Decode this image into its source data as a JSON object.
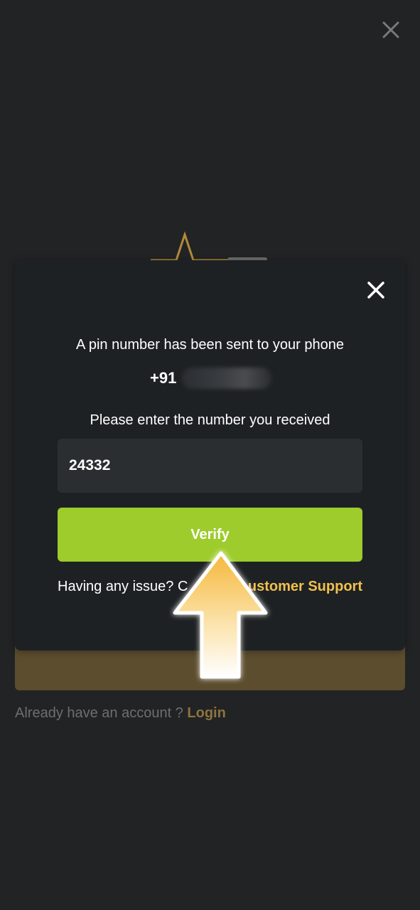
{
  "icons": {
    "top_close": "close-icon",
    "modal_close": "close-icon",
    "logo": "star-logo-icon",
    "arrow": "arrow-up-icon"
  },
  "colors": {
    "background": "#222324",
    "modal": "#1e2124",
    "verify_button": "#9dcc2c",
    "link_gold": "#f0c14b",
    "muted_gold": "#8c7440",
    "input_bg": "#2a2e31"
  },
  "background_page": {
    "footer_prefix": "Already have an account ?",
    "login_link": "Login"
  },
  "modal": {
    "pin_sent_message": "A pin number has been sent to your phone",
    "phone_prefix": "+91",
    "enter_prompt": "Please enter the number you received",
    "pin_value": "24332",
    "verify_label": "Verify",
    "issue_prefix": "Having any issue? C",
    "support_link": "ustomer Support"
  }
}
